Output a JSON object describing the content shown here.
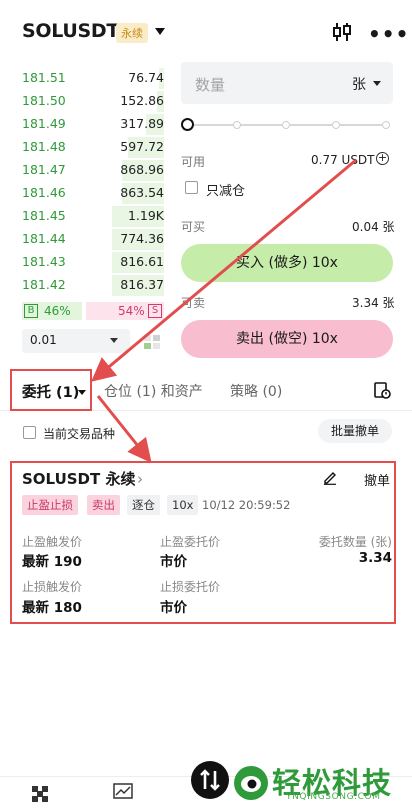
{
  "header": {
    "symbol": "SOLUSDT",
    "contract_tag": "永续",
    "more": "•••"
  },
  "orderbook": {
    "rows": [
      {
        "price": "181.51",
        "qty": "76.74",
        "depth": 0.07
      },
      {
        "price": "181.50",
        "qty": "152.86",
        "depth": 0.1
      },
      {
        "price": "181.49",
        "qty": "317.89",
        "depth": 0.25
      },
      {
        "price": "181.48",
        "qty": "597.72",
        "depth": 0.5
      },
      {
        "price": "181.47",
        "qty": "868.96",
        "depth": 0.58
      },
      {
        "price": "181.46",
        "qty": "863.54",
        "depth": 0.58
      },
      {
        "price": "181.45",
        "qty": "1.19K",
        "depth": 0.72
      },
      {
        "price": "181.44",
        "qty": "774.36",
        "depth": 0.72
      },
      {
        "price": "181.43",
        "qty": "816.61",
        "depth": 0.72
      },
      {
        "price": "181.42",
        "qty": "816.37",
        "depth": 0.72
      }
    ],
    "buy_label": "B",
    "buy_pct": "46%",
    "sell_pct": "54%",
    "sell_label": "S",
    "precision": "0.01"
  },
  "trade": {
    "qty_placeholder": "数量",
    "qty_unit": "张",
    "available_label": "可用",
    "available_value": "0.77 USDT",
    "reduce_only": "只减仓",
    "can_buy_label": "可买",
    "can_buy_value": "0.04 张",
    "buy_button": "买入 (做多) 10x",
    "can_sell_label": "可卖",
    "can_sell_value": "3.34 张",
    "sell_button": "卖出 (做空) 10x"
  },
  "tabs": {
    "orders": "委托 (1)",
    "positions": "仓位 (1) 和资产",
    "strategy": "策略 (0)"
  },
  "filter": {
    "current_symbol": "当前交易品种",
    "batch_cancel": "批量撤单"
  },
  "order": {
    "title": "SOLUSDT 永续",
    "chevron": "›",
    "cancel": "撤单",
    "tags": [
      "止盈止损",
      "卖出",
      "逐仓",
      "10x"
    ],
    "time": "10/12 20:59:52",
    "tp_trigger_label": "止盈触发价",
    "tp_trigger_value": "最新 190",
    "tp_order_label": "止盈委托价",
    "tp_order_value": "市价",
    "qty_label": "委托数量 (张)",
    "qty_value": "3.34",
    "sl_trigger_label": "止损触发价",
    "sl_trigger_value": "最新 180",
    "sl_order_label": "止损委托价",
    "sl_order_value": "市价"
  },
  "watermark": {
    "brand": "轻松科技",
    "url": "YNQINGSONG.COM"
  },
  "colors": {
    "buy": "#2f9a3a",
    "sell": "#d23a6a",
    "annotation": "#e24d4d"
  }
}
